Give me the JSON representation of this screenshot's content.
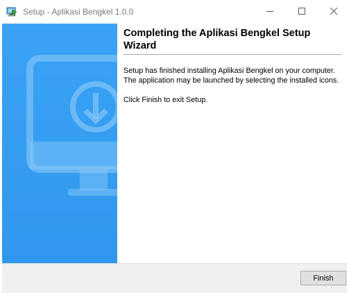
{
  "window": {
    "title": "Setup - Aplikasi Bengkel 1.0.0",
    "app_icon": "installer-icon",
    "controls": {
      "minimize_icon": "minimize-icon",
      "maximize_icon": "maximize-icon",
      "close_icon": "close-icon"
    }
  },
  "sidebar": {
    "illustration": "monitor-download-icon",
    "background_color": "#3aa3f5"
  },
  "main": {
    "heading": "Completing the Aplikasi Bengkel Setup Wizard",
    "paragraph_1": "Setup has finished installing Aplikasi Bengkel on your computer. The application may be launched by selecting the installed icons.",
    "paragraph_2": "Click Finish to exit Setup."
  },
  "footer": {
    "finish_label": "Finish"
  }
}
